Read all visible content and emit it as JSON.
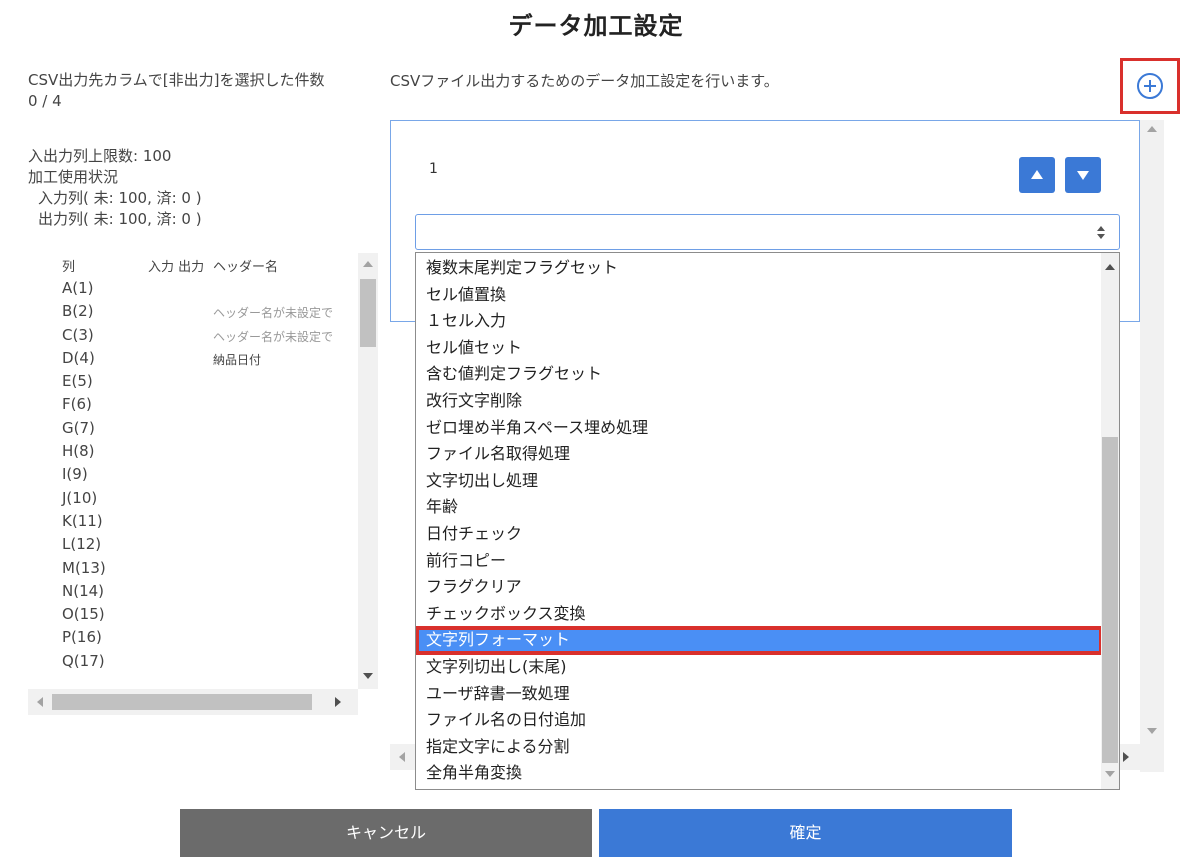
{
  "page": {
    "title": "データ加工設定"
  },
  "left": {
    "selected_label": "CSV出力先カラムで[非出力]を選択した件数",
    "selected_value": "0 / 4",
    "limit_label": "入出力列上限数: 100",
    "usage_title": "加工使用状況",
    "input_usage": "入力列( 未: 100, 済: 0 )",
    "output_usage": "出力列( 未: 100, 済: 0 )",
    "table": {
      "headers": {
        "col": "列",
        "io": "入力 出力",
        "header_name": "ヘッダー名"
      },
      "rows": [
        {
          "col": "A(1)",
          "header": ""
        },
        {
          "col": "B(2)",
          "header": "ヘッダー名が未設定で"
        },
        {
          "col": "C(3)",
          "header": "ヘッダー名が未設定で"
        },
        {
          "col": "D(4)",
          "header": "納品日付"
        },
        {
          "col": "E(5)",
          "header": ""
        },
        {
          "col": "F(6)",
          "header": ""
        },
        {
          "col": "G(7)",
          "header": ""
        },
        {
          "col": "H(8)",
          "header": ""
        },
        {
          "col": "I(9)",
          "header": ""
        },
        {
          "col": "J(10)",
          "header": ""
        },
        {
          "col": "K(11)",
          "header": ""
        },
        {
          "col": "L(12)",
          "header": ""
        },
        {
          "col": "M(13)",
          "header": ""
        },
        {
          "col": "N(14)",
          "header": ""
        },
        {
          "col": "O(15)",
          "header": ""
        },
        {
          "col": "P(16)",
          "header": ""
        },
        {
          "col": "Q(17)",
          "header": ""
        }
      ]
    }
  },
  "right": {
    "description": "CSVファイル出力するためのデータ加工設定を行います。",
    "add_icon": "plus-circle-icon",
    "rule": {
      "number": "1"
    },
    "select": {
      "value": ""
    },
    "dropdown_options": [
      "複数末尾判定フラグセット",
      "セル値置換",
      "１セル入力",
      "セル値セット",
      "含む値判定フラグセット",
      "改行文字削除",
      "ゼロ埋め半角スペース埋め処理",
      "ファイル名取得処理",
      "文字切出し処理",
      "年齢",
      "日付チェック",
      "前行コピー",
      "フラグクリア",
      "チェックボックス変換",
      "文字列フォーマット",
      "文字列切出し(末尾)",
      "ユーザ辞書一致処理",
      "ファイル名の日付追加",
      "指定文字による分割",
      "全角半角変換"
    ],
    "selected_option": "文字列フォーマット"
  },
  "footer": {
    "cancel_label": "キャンセル",
    "ok_label": "確定"
  },
  "colors": {
    "primary": "#3b79d6",
    "highlight": "#d9302c",
    "selected_bg": "#4a8ff5",
    "cancel": "#6b6b6b"
  }
}
